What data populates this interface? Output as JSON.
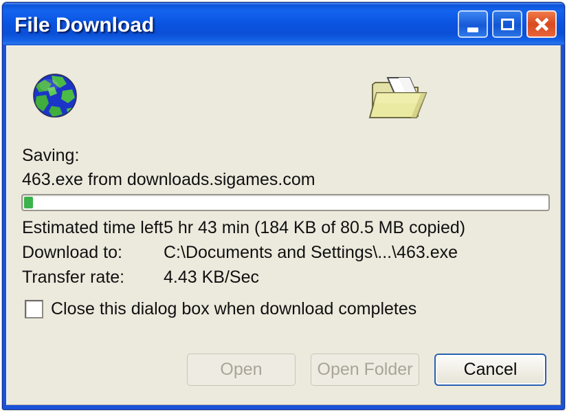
{
  "window": {
    "title": "File Download",
    "buttons": {
      "minimize": "minimize-button",
      "maximize": "maximize-button",
      "close": "close-button"
    },
    "accent_color": "#0a54e2",
    "client_bg": "#ece9dd"
  },
  "icons": {
    "source": "globe-icon",
    "destination": "open-folder-icon"
  },
  "content": {
    "saving_label": "Saving:",
    "saving_file": "463.exe from downloads.sigames.com",
    "eta_label": "Estimated time left",
    "eta_value": "5 hr 43 min (184 KB of 80.5 MB copied)",
    "download_to_label": "Download to:",
    "download_to_value": "C:\\Documents and Settings\\...\\463.exe",
    "transfer_rate_label": "Transfer rate:",
    "transfer_rate_value": "4.43 KB/Sec"
  },
  "progress": {
    "percent": 0.22,
    "bytes_copied": "184 KB",
    "bytes_total": "80.5 MB",
    "fill_color": "#3cb34a"
  },
  "checkbox": {
    "label": "Close this dialog box when download completes",
    "checked": false
  },
  "buttons": {
    "open": "Open",
    "open_folder": "Open Folder",
    "cancel": "Cancel"
  }
}
